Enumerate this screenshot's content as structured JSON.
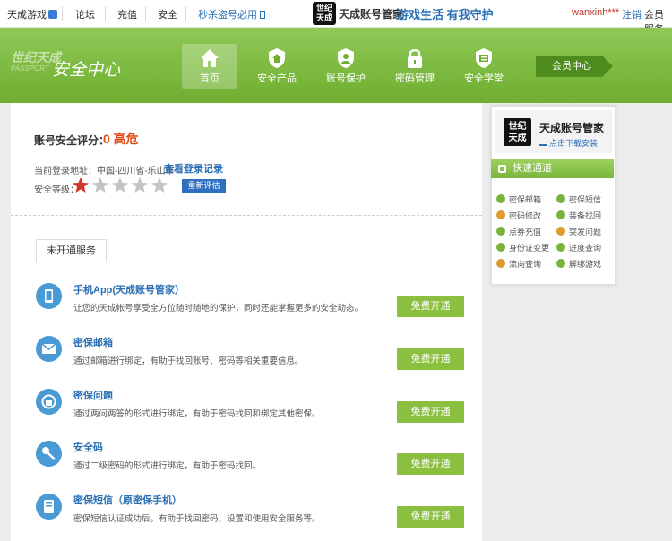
{
  "topbar": {
    "game_menu": "天成游戏",
    "forum": "论坛",
    "recharge": "充值",
    "security": "安全",
    "promo": "秒杀盗号必用",
    "manager_title": "天成账号管家",
    "slogan": "游戏生活 有我守护",
    "username": "wanxinh***",
    "logout": "注销",
    "member_service": "会员服务"
  },
  "header": {
    "brand_line1": "世纪天成",
    "brand_line2": "PASSPORT",
    "brand_title": "安全中心",
    "nav": [
      {
        "label": "首页",
        "icon": "home-icon"
      },
      {
        "label": "安全产品",
        "icon": "shield-house-icon"
      },
      {
        "label": "账号保护",
        "icon": "user-shield-icon"
      },
      {
        "label": "密码管理",
        "icon": "lock-icon"
      },
      {
        "label": "安全学堂",
        "icon": "book-shield-icon"
      }
    ],
    "member_center": "会员中心"
  },
  "main": {
    "score_label": "账号安全评分：",
    "score_value": "0 高危",
    "location": "当前登录地址：中国-四川省-乐山市-",
    "location_link": "查看登录记录",
    "level_label": "安全等级：",
    "stars_filled": 1,
    "stars_total": 5,
    "reevaluate": "重新评估",
    "tab_label": "未开通服务",
    "services": [
      {
        "title": "手机App(天成账号管家）",
        "desc": "让您的天成帐号享受全方位随时随地的保护，同时还能掌握更多的安全动态。",
        "button": "免费开通",
        "icon": "phone-icon"
      },
      {
        "title": "密保邮箱",
        "desc": "通过邮箱进行绑定，有助于找回账号、密码等相关重要信息。",
        "button": "免费开通",
        "icon": "envelope-icon"
      },
      {
        "title": "密保问题",
        "desc": "通过两问两答的形式进行绑定，有助于密码找回和绑定其他密保。",
        "button": "免费开通",
        "icon": "question-lock-icon"
      },
      {
        "title": "安全码",
        "desc": "通过二级密码的形式进行绑定，有助于密码找回。",
        "button": "免费开通",
        "icon": "key-icon"
      },
      {
        "title": "密保短信（原密保手机）",
        "desc": "密保短信认证成功后，有助于找回密码、设置和使用安全服务等。",
        "button": "免费开通",
        "icon": "sms-icon"
      }
    ]
  },
  "sidebar": {
    "manager_title": "天成账号管家",
    "download": "点击下载安装",
    "quick_title": "快速通道",
    "quick_links": [
      "密保邮箱",
      "密保短信",
      "密码修改",
      "装备找回",
      "点券充值",
      "突发问题",
      "身份证变更",
      "进度查询",
      "流向查询",
      "解绑游戏"
    ]
  },
  "colors": {
    "accent_green": "#7cba3d",
    "danger": "#e04a16",
    "link_blue": "#2b6fb5"
  }
}
